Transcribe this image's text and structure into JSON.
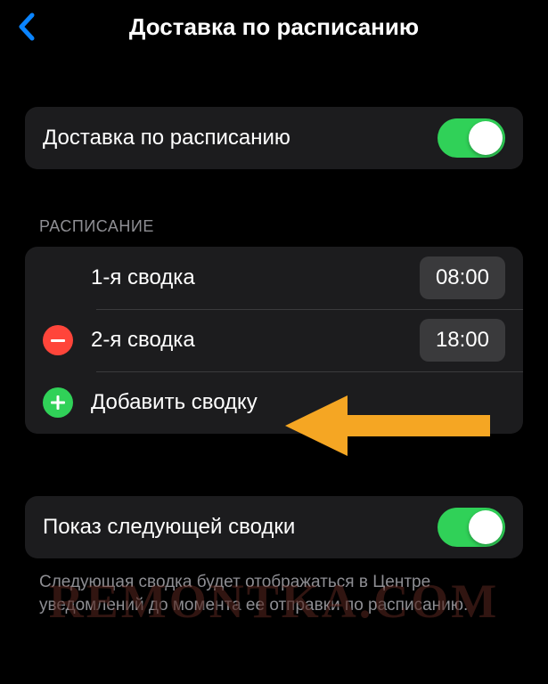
{
  "header": {
    "title": "Доставка по расписанию"
  },
  "main_toggle": {
    "label": "Доставка по расписанию",
    "on": true
  },
  "schedule": {
    "section_title": "РАСПИСАНИЕ",
    "rows": [
      {
        "label": "1-я сводка",
        "time": "08:00",
        "deletable": false
      },
      {
        "label": "2-я сводка",
        "time": "18:00",
        "deletable": true
      }
    ],
    "add_label": "Добавить сводку"
  },
  "next_summary": {
    "label": "Показ следующей сводки",
    "on": true,
    "footer": "Следующая сводка будет отображаться в Центре уведомлений до момента ее отправки по расписанию."
  },
  "watermark": "REMONTKA.COM",
  "colors": {
    "accent_green": "#30d158",
    "accent_red": "#ff453a",
    "accent_blue": "#0a84ff",
    "arrow": "#f5a623"
  }
}
